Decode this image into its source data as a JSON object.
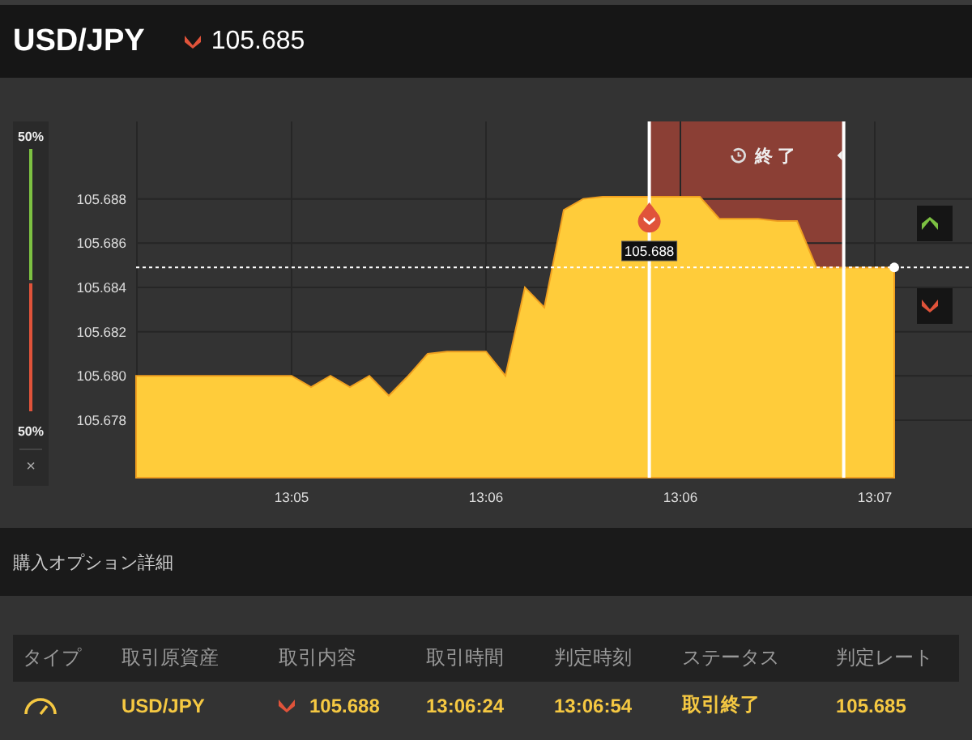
{
  "header": {
    "pair": "USD/JPY",
    "rising": false,
    "price": "105.685"
  },
  "sentiment": {
    "top_label": "50%",
    "bottom_label": "50%",
    "level": 0.5,
    "close": "×"
  },
  "chart": {
    "expiry_label": "終了",
    "chart_data": {
      "type": "area",
      "grid": true,
      "categories": [
        null,
        null,
        null,
        null,
        null,
        null,
        null,
        null,
        "13:05",
        null,
        null,
        null,
        null,
        null,
        null,
        null,
        null,
        null,
        "13:06",
        null,
        null,
        null,
        null,
        null,
        null,
        null,
        null,
        null,
        "13:06",
        null,
        null,
        null,
        null,
        null,
        null,
        null,
        null,
        null,
        "13:07",
        null
      ],
      "ylim": [
        105.6754,
        105.6915
      ],
      "yticks": [
        {
          "value": 105.678,
          "label": "105.678"
        },
        {
          "value": 105.68,
          "label": "105.680"
        },
        {
          "value": 105.682,
          "label": "105.682"
        },
        {
          "value": 105.684,
          "label": "105.684"
        },
        {
          "value": 105.686,
          "label": "105.686"
        },
        {
          "value": 105.688,
          "label": "105.688"
        }
      ],
      "series": [
        {
          "color": "#ffcc3a",
          "values": [
            105.68,
            105.68,
            105.68,
            105.68,
            105.68,
            105.68,
            105.68,
            105.68,
            105.68,
            105.6795,
            105.68,
            105.6795,
            105.68,
            105.6791,
            105.68,
            105.681,
            105.6811,
            105.6811,
            105.6811,
            105.68,
            105.684,
            105.6831,
            105.6875,
            105.688,
            105.6881,
            105.6881,
            105.6881,
            105.6881,
            105.6881,
            105.6881,
            105.6871,
            105.6871,
            105.6871,
            105.687,
            105.687,
            105.6849,
            105.6849,
            105.6849,
            105.6849,
            105.6849
          ]
        }
      ],
      "annotations": [
        "105.688"
      ]
    }
  },
  "section_title": "購入オプション詳細",
  "table": {
    "columns": [
      "タイプ",
      "取引原資産",
      "取引内容",
      "取引時間",
      "判定時刻",
      "ステータス",
      "判定レート"
    ],
    "rows": [
      {
        "asset": "USD/JPY",
        "rising": false,
        "rate": "105.688",
        "trade_time": "13:06:24",
        "judge_time": "13:06:54",
        "status": "取引終了",
        "judge_rate": "105.685"
      }
    ]
  }
}
